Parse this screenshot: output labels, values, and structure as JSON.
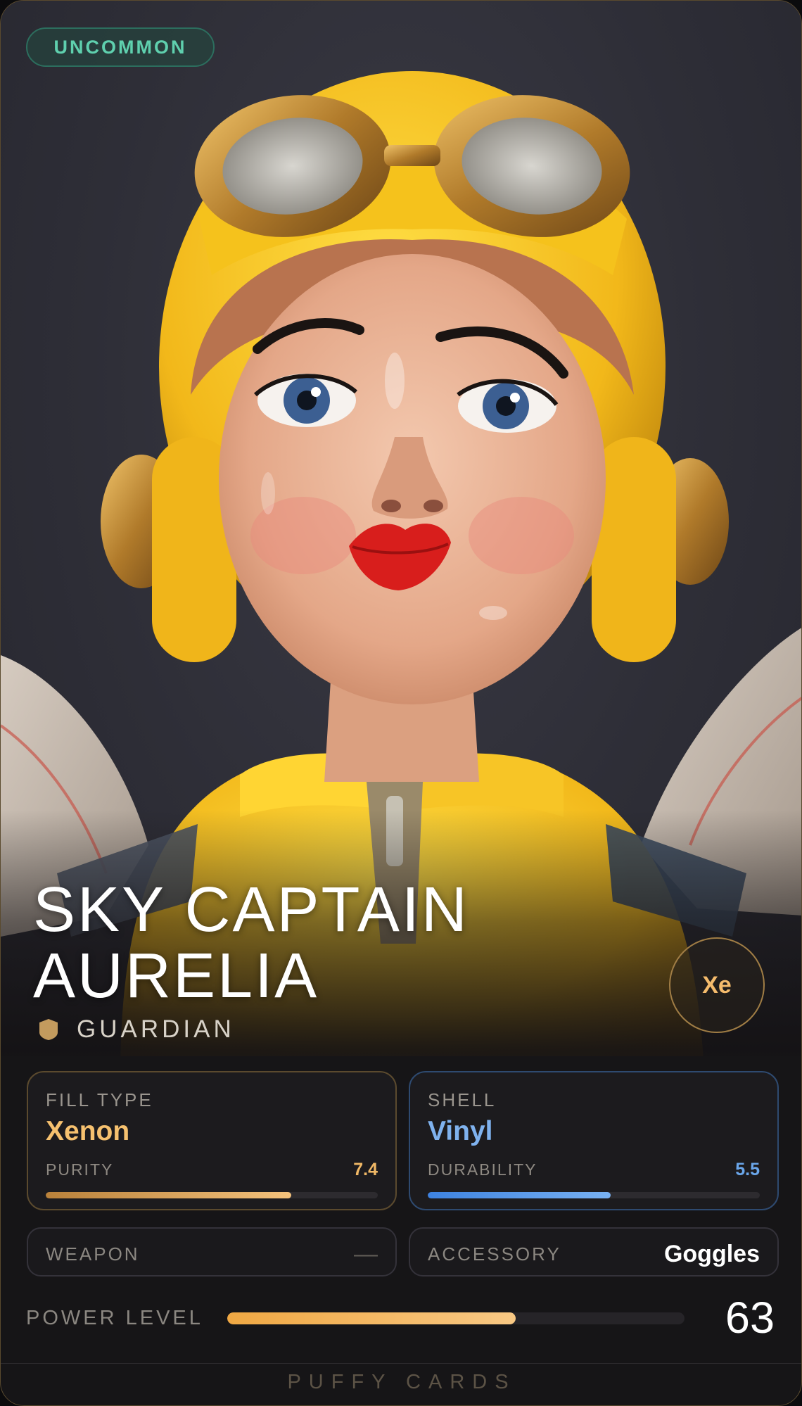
{
  "card": {
    "rarity": "UNCOMMON",
    "name_line1": "SKY CAPTAIN",
    "name_line2": "AURELIA",
    "class_label": "GUARDIAN",
    "class_icon": "shield-icon",
    "element_symbol": "Xe"
  },
  "stats": {
    "fill": {
      "title": "FILL TYPE",
      "value": "Xenon",
      "sub_label": "PURITY",
      "sub_value": "7.4",
      "level": 0.74
    },
    "shell": {
      "title": "SHELL",
      "value": "Vinyl",
      "sub_label": "DURABILITY",
      "sub_value": "5.5",
      "level": 0.55
    }
  },
  "slots": {
    "weapon": {
      "label": "WEAPON",
      "value": "—"
    },
    "accessory": {
      "label": "ACCESSORY",
      "value": "Goggles"
    }
  },
  "power": {
    "label": "POWER LEVEL",
    "value": "63",
    "level": 0.63
  },
  "footer": {
    "brand": "PUFFY CARDS"
  },
  "colors": {
    "rarity": "#5fd0ae",
    "fill_accent": "#f6c16f",
    "shell_accent": "#7fb2ee",
    "power_accent": "#f0a843"
  }
}
